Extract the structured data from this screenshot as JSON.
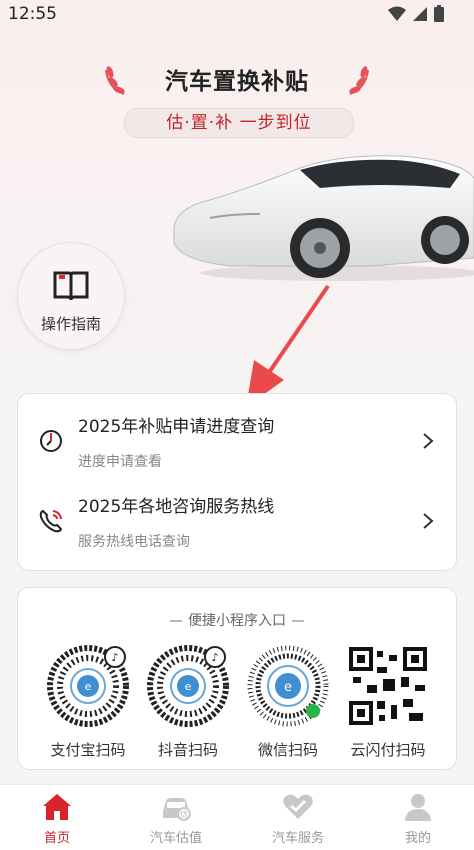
{
  "status_bar": {
    "time": "12:55"
  },
  "hero": {
    "title": "汽车置换补贴",
    "slogan": "估·置·补 一步到位",
    "accent_color": "#c4232b"
  },
  "guide": {
    "label": "操作指南",
    "icon": "book-icon"
  },
  "menu": [
    {
      "title": "2025年补贴申请进度查询",
      "subtitle": "进度申请查看",
      "icon": "clock-icon"
    },
    {
      "title": "2025年各地咨询服务热线",
      "subtitle": "服务热线电话查询",
      "icon": "phone-icon"
    }
  ],
  "quick_entry": {
    "header": "便捷小程序入口",
    "items": [
      {
        "label": "支付宝扫码",
        "icon": "alipay-qr-code"
      },
      {
        "label": "抖音扫码",
        "icon": "douyin-qr-code"
      },
      {
        "label": "微信扫码",
        "icon": "wechat-qr-code"
      },
      {
        "label": "云闪付扫码",
        "icon": "unionpay-qr-code"
      }
    ]
  },
  "bottom_nav": [
    {
      "label": "首页",
      "icon": "home-icon",
      "active": true
    },
    {
      "label": "汽车估值",
      "icon": "car-valuation-icon",
      "active": false
    },
    {
      "label": "汽车服务",
      "icon": "heart-handshake-icon",
      "active": false
    },
    {
      "label": "我的",
      "icon": "user-icon",
      "active": false
    }
  ]
}
